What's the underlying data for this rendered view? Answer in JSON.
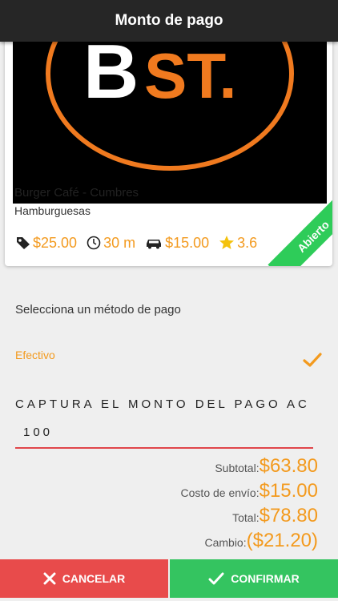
{
  "header": {
    "title": "Monto de pago"
  },
  "restaurant": {
    "name": "Burger Café - Cumbres",
    "category": "Hamburguesas",
    "status": "Abierto",
    "logo_text": {
      "b": "B",
      "st": "ST."
    },
    "stats": {
      "min_order": "$25.00",
      "time": "30 m",
      "delivery": "$15.00",
      "rating": "3.6"
    }
  },
  "payment": {
    "section_label": "Selecciona un método de pago",
    "method": "Efectivo",
    "amount_label": "CAPTURA EL MONTO DEL PAGO AC",
    "amount_value": "100"
  },
  "totals": {
    "subtotal_label": "Subtotal:",
    "subtotal": "$63.80",
    "shipping_label": "Costo de envío:",
    "shipping": "$15.00",
    "total_label": "Total:",
    "total": "$78.80",
    "change_label": "Cambio:",
    "change": "($21.20)"
  },
  "buttons": {
    "cancel": "CANCELAR",
    "confirm": "CONFIRMAR"
  },
  "colors": {
    "accent": "#f39a1e",
    "cancel": "#e84b4b",
    "confirm": "#34c460",
    "header": "#262626"
  }
}
